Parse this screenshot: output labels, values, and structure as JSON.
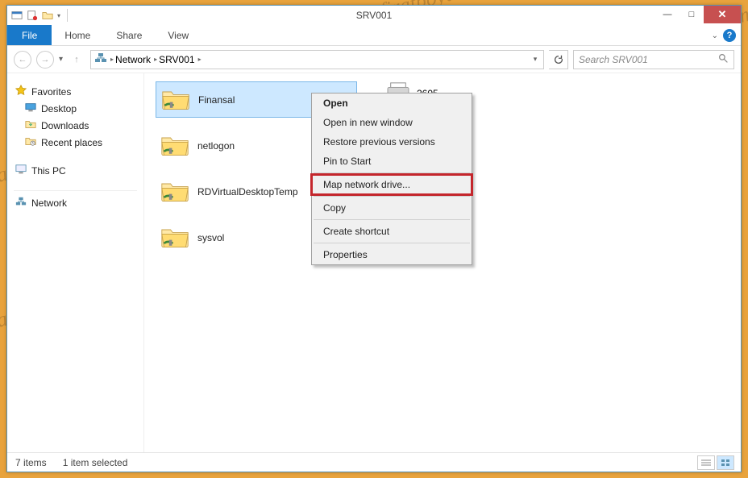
{
  "window": {
    "title": "SRV001",
    "controls": {
      "min": "—",
      "max": "□",
      "close": "✕"
    }
  },
  "ribbon": {
    "file": "File",
    "tabs": [
      "Home",
      "Share",
      "View"
    ]
  },
  "addressbar": {
    "segments": [
      "Network",
      "SRV001"
    ],
    "refresh_tooltip": "Refresh"
  },
  "search": {
    "placeholder": "Search SRV001"
  },
  "sidebar": {
    "favorites": {
      "label": "Favorites",
      "items": [
        "Desktop",
        "Downloads",
        "Recent places"
      ]
    },
    "thispc": {
      "label": "This PC"
    },
    "network": {
      "label": "Network"
    }
  },
  "content": {
    "items": [
      {
        "name": "Finansal",
        "selected": true
      },
      {
        "name": "netlogon",
        "selected": false
      },
      {
        "name": "RDVirtualDesktopTemp",
        "selected": false
      },
      {
        "name": "sysvol",
        "selected": false
      }
    ],
    "extra_item_suffix": "2605"
  },
  "context_menu": {
    "items": [
      {
        "label": "Open",
        "bold": true
      },
      {
        "label": "Open in new window"
      },
      {
        "label": "Restore previous versions"
      },
      {
        "label": "Pin to Start"
      },
      {
        "sep": true
      },
      {
        "label": "Map network drive...",
        "highlight": true
      },
      {
        "sep": true
      },
      {
        "label": "Copy"
      },
      {
        "sep": true
      },
      {
        "label": "Create shortcut"
      },
      {
        "sep": true
      },
      {
        "label": "Properties"
      }
    ]
  },
  "status": {
    "count": "7 items",
    "selection": "1 item selected"
  },
  "watermark": "firatboyan.com"
}
